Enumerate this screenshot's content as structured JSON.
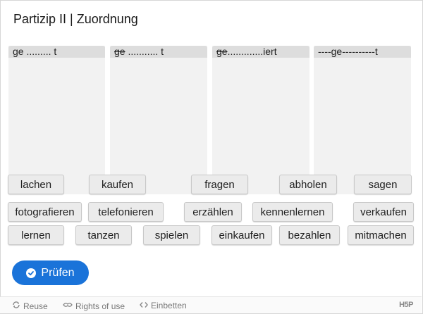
{
  "title": "Partizip II | Zuordnung",
  "zones": [
    {
      "prefix_plain": "ge ......... t",
      "strike": "",
      "rest": ""
    },
    {
      "prefix_plain": "",
      "strike": "ge",
      "rest": " ........... t"
    },
    {
      "prefix_plain": "",
      "strike": "ge",
      "rest": ".............iert"
    },
    {
      "prefix_plain": "----ge----------t",
      "strike": "",
      "rest": ""
    }
  ],
  "words": {
    "lachen": "lachen",
    "kaufen": "kaufen",
    "fragen": "fragen",
    "abholen": "abholen",
    "sagen": "sagen",
    "fotografieren": "fotografieren",
    "telefonieren": "telefonieren",
    "erzaehlen": "erzählen",
    "kennenlernen": "kennenlernen",
    "verkaufen": "verkaufen",
    "lernen": "lernen",
    "tanzen": "tanzen",
    "spielen": "spielen",
    "einkaufen": "einkaufen",
    "bezahlen": "bezahlen",
    "mitmachen": "mitmachen"
  },
  "check_button": "Prüfen",
  "footer": {
    "reuse": "Reuse",
    "rights": "Rights of use",
    "embed": "Einbetten",
    "logo": "H5P"
  },
  "colors": {
    "accent": "#1a73d9",
    "zone_bg": "#f2f2f2",
    "zone_header": "#dddddd"
  }
}
